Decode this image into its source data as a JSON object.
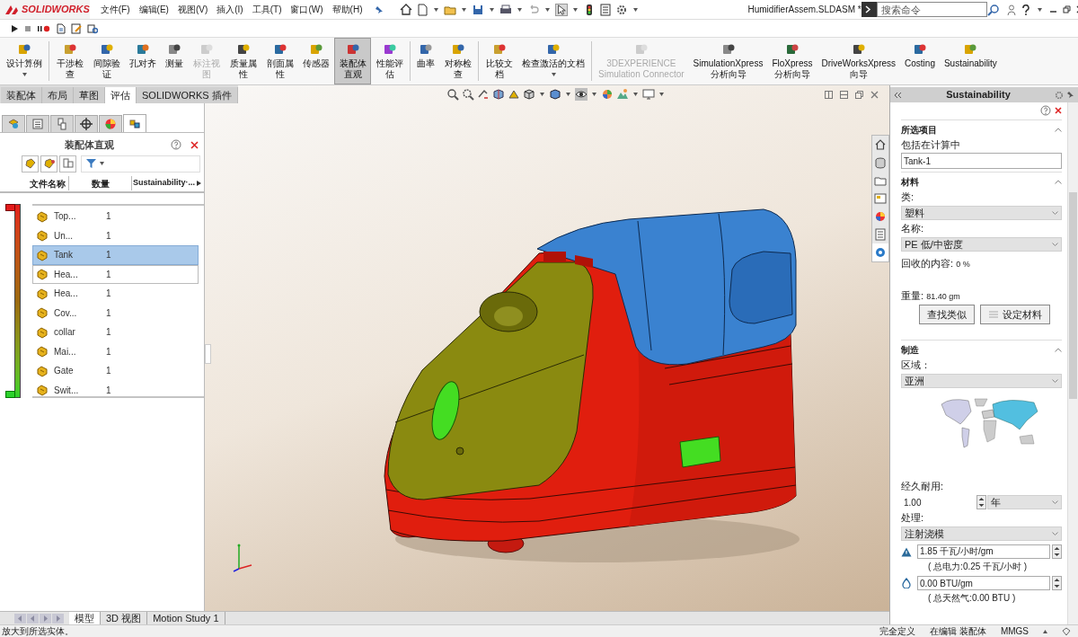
{
  "title_bar": {
    "app_name": "SOLIDWORKS",
    "menus": [
      "文件(F)",
      "编辑(E)",
      "视图(V)",
      "插入(I)",
      "工具(T)",
      "窗口(W)",
      "帮助(H)"
    ],
    "document_title": "HumidifierAssem.SLDASM *",
    "search_placeholder": "搜索命令"
  },
  "ribbon": {
    "groups": [
      [
        {
          "label": "设计算例",
          "has_menu": true,
          "disabled": false,
          "selected": false
        }
      ],
      [
        {
          "label": "干涉检查",
          "has_menu": false,
          "disabled": false,
          "selected": false
        },
        {
          "label": "间隙验证",
          "has_menu": false,
          "disabled": false,
          "selected": false
        },
        {
          "label": "孔对齐",
          "has_menu": false,
          "disabled": false,
          "selected": false
        },
        {
          "label": "测量",
          "has_menu": false,
          "disabled": false,
          "selected": false
        },
        {
          "label": "标注视图",
          "has_menu": false,
          "disabled": true,
          "selected": false
        },
        {
          "label": "质量属性",
          "has_menu": false,
          "disabled": false,
          "selected": false
        },
        {
          "label": "剖面属性",
          "has_menu": false,
          "disabled": false,
          "selected": false
        },
        {
          "label": "传感器",
          "has_menu": false,
          "disabled": false,
          "selected": false
        },
        {
          "label": "装配体直观",
          "has_menu": false,
          "disabled": false,
          "selected": true
        },
        {
          "label": "性能评估",
          "has_menu": false,
          "disabled": false,
          "selected": false
        }
      ],
      [
        {
          "label": "曲率",
          "has_menu": false,
          "disabled": false,
          "selected": false
        },
        {
          "label": "对称检查",
          "has_menu": false,
          "disabled": false,
          "selected": false
        }
      ],
      [
        {
          "label": "比较文档",
          "has_menu": false,
          "disabled": false,
          "selected": false
        },
        {
          "label": "检查激活的文档",
          "has_menu": true,
          "disabled": false,
          "selected": false
        }
      ],
      [
        {
          "label": "3DEXPERIENCE\nSimulation Connector",
          "has_menu": false,
          "disabled": true,
          "selected": false
        },
        {
          "label": "SimulationXpress\n分析向导",
          "has_menu": false,
          "disabled": false,
          "selected": false
        },
        {
          "label": "FloXpress\n分析向导",
          "has_menu": false,
          "disabled": false,
          "selected": false
        },
        {
          "label": "DriveWorksXpress\n向导",
          "has_menu": false,
          "disabled": false,
          "selected": false
        },
        {
          "label": "Costing",
          "has_menu": false,
          "disabled": false,
          "selected": false
        },
        {
          "label": "Sustainability",
          "has_menu": false,
          "disabled": false,
          "selected": false
        }
      ]
    ]
  },
  "command_tabs": [
    {
      "label": "装配体",
      "selected": false
    },
    {
      "label": "布局",
      "selected": false
    },
    {
      "label": "草图",
      "selected": false
    },
    {
      "label": "评估",
      "selected": true
    },
    {
      "label": "SOLIDWORKS 插件",
      "selected": false
    }
  ],
  "left_panel": {
    "tabs": [
      {
        "selected": false
      },
      {
        "selected": false
      },
      {
        "selected": false
      },
      {
        "selected": false
      },
      {
        "selected": false
      },
      {
        "selected": true
      }
    ],
    "title": "装配体直观",
    "columns": [
      "文件名称",
      "数量",
      "Sustainability·..."
    ],
    "rows": [
      {
        "name": "Top...",
        "quantity": "1",
        "selected": false,
        "hovered": false
      },
      {
        "name": "Un...",
        "quantity": "1",
        "selected": false,
        "hovered": false
      },
      {
        "name": "Tank",
        "quantity": "1",
        "selected": true,
        "hovered": false
      },
      {
        "name": "Hea...",
        "quantity": "1",
        "selected": false,
        "hovered": true
      },
      {
        "name": "Hea...",
        "quantity": "1",
        "selected": false,
        "hovered": false
      },
      {
        "name": "Cov...",
        "quantity": "1",
        "selected": false,
        "hovered": false
      },
      {
        "name": "collar",
        "quantity": "1",
        "selected": false,
        "hovered": false
      },
      {
        "name": "Mai...",
        "quantity": "1",
        "selected": false,
        "hovered": false
      },
      {
        "name": "Gate",
        "quantity": "1",
        "selected": false,
        "hovered": false
      },
      {
        "name": "Swit...",
        "quantity": "1",
        "selected": false,
        "hovered": false
      }
    ]
  },
  "task_pane_tabs": [
    {
      "selected": false
    },
    {
      "selected": false
    },
    {
      "selected": false
    },
    {
      "selected": false
    },
    {
      "selected": false
    },
    {
      "selected": false
    },
    {
      "selected": true
    }
  ],
  "task_pane": {
    "title": "Sustainability",
    "sections": [
      {
        "title": "所选项目",
        "items": [
          {
            "kind": "label",
            "text": "包括在计算中"
          },
          {
            "kind": "input",
            "value": "Tank-1"
          }
        ]
      },
      {
        "title": "材料",
        "items": [
          {
            "kind": "label",
            "text": "类:"
          },
          {
            "kind": "select",
            "value": "塑料"
          },
          {
            "kind": "label",
            "text": "名称:"
          },
          {
            "kind": "select",
            "value": "PE 低/中密度"
          },
          {
            "kind": "reading",
            "label": "回收的内容:",
            "value": "0 %"
          },
          {
            "kind": "reading",
            "label": "重量:",
            "value": "81.40 gm"
          },
          {
            "kind": "buttons",
            "buttons": [
              "查找类似",
              "设定材料"
            ]
          }
        ]
      },
      {
        "title": "制造",
        "items": [
          {
            "kind": "label",
            "text": "区域："
          },
          {
            "kind": "select",
            "value": "亚洲"
          },
          {
            "kind": "map"
          },
          {
            "kind": "label",
            "text": "经久耐用:"
          },
          {
            "kind": "spin_select",
            "value": "1.00",
            "unit": "年"
          },
          {
            "kind": "label",
            "text": "处理:"
          },
          {
            "kind": "select",
            "value": "注射浇模"
          },
          {
            "kind": "electricity",
            "value": "1.85 千瓦/小时/gm"
          },
          {
            "kind": "note",
            "text": "( 总电力:0.25 千瓦/小时 )"
          },
          {
            "kind": "gas",
            "value": "0.00 BTU/gm"
          },
          {
            "kind": "note",
            "text": "( 总天然气:0.00 BTU )"
          }
        ]
      }
    ]
  },
  "bottom_tabs": [
    {
      "label": "模型",
      "selected": true
    },
    {
      "label": "3D 视图",
      "selected": false
    },
    {
      "label": "Motion Study 1",
      "selected": false
    }
  ],
  "status_bar": {
    "message": "放大到所选实体。",
    "items": [
      "完全定义",
      "在编辑 装配体",
      "MMGS"
    ]
  }
}
